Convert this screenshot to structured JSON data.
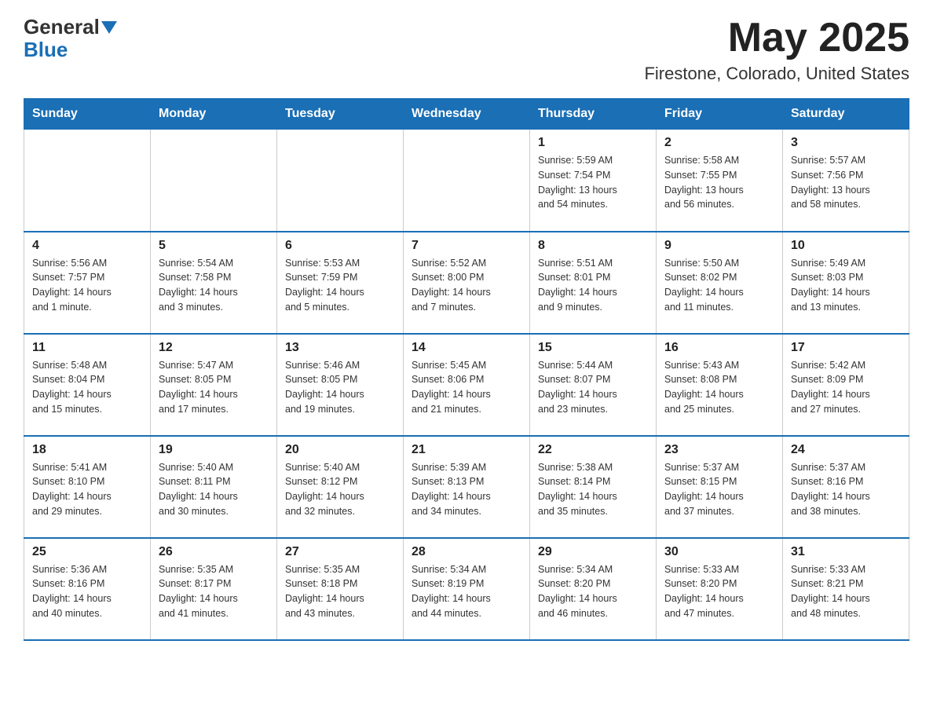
{
  "header": {
    "logo_text_black": "General",
    "logo_text_blue": "Blue",
    "title": "May 2025",
    "subtitle": "Firestone, Colorado, United States"
  },
  "days_of_week": [
    "Sunday",
    "Monday",
    "Tuesday",
    "Wednesday",
    "Thursday",
    "Friday",
    "Saturday"
  ],
  "weeks": [
    [
      {
        "day": "",
        "info": ""
      },
      {
        "day": "",
        "info": ""
      },
      {
        "day": "",
        "info": ""
      },
      {
        "day": "",
        "info": ""
      },
      {
        "day": "1",
        "info": "Sunrise: 5:59 AM\nSunset: 7:54 PM\nDaylight: 13 hours\nand 54 minutes."
      },
      {
        "day": "2",
        "info": "Sunrise: 5:58 AM\nSunset: 7:55 PM\nDaylight: 13 hours\nand 56 minutes."
      },
      {
        "day": "3",
        "info": "Sunrise: 5:57 AM\nSunset: 7:56 PM\nDaylight: 13 hours\nand 58 minutes."
      }
    ],
    [
      {
        "day": "4",
        "info": "Sunrise: 5:56 AM\nSunset: 7:57 PM\nDaylight: 14 hours\nand 1 minute."
      },
      {
        "day": "5",
        "info": "Sunrise: 5:54 AM\nSunset: 7:58 PM\nDaylight: 14 hours\nand 3 minutes."
      },
      {
        "day": "6",
        "info": "Sunrise: 5:53 AM\nSunset: 7:59 PM\nDaylight: 14 hours\nand 5 minutes."
      },
      {
        "day": "7",
        "info": "Sunrise: 5:52 AM\nSunset: 8:00 PM\nDaylight: 14 hours\nand 7 minutes."
      },
      {
        "day": "8",
        "info": "Sunrise: 5:51 AM\nSunset: 8:01 PM\nDaylight: 14 hours\nand 9 minutes."
      },
      {
        "day": "9",
        "info": "Sunrise: 5:50 AM\nSunset: 8:02 PM\nDaylight: 14 hours\nand 11 minutes."
      },
      {
        "day": "10",
        "info": "Sunrise: 5:49 AM\nSunset: 8:03 PM\nDaylight: 14 hours\nand 13 minutes."
      }
    ],
    [
      {
        "day": "11",
        "info": "Sunrise: 5:48 AM\nSunset: 8:04 PM\nDaylight: 14 hours\nand 15 minutes."
      },
      {
        "day": "12",
        "info": "Sunrise: 5:47 AM\nSunset: 8:05 PM\nDaylight: 14 hours\nand 17 minutes."
      },
      {
        "day": "13",
        "info": "Sunrise: 5:46 AM\nSunset: 8:05 PM\nDaylight: 14 hours\nand 19 minutes."
      },
      {
        "day": "14",
        "info": "Sunrise: 5:45 AM\nSunset: 8:06 PM\nDaylight: 14 hours\nand 21 minutes."
      },
      {
        "day": "15",
        "info": "Sunrise: 5:44 AM\nSunset: 8:07 PM\nDaylight: 14 hours\nand 23 minutes."
      },
      {
        "day": "16",
        "info": "Sunrise: 5:43 AM\nSunset: 8:08 PM\nDaylight: 14 hours\nand 25 minutes."
      },
      {
        "day": "17",
        "info": "Sunrise: 5:42 AM\nSunset: 8:09 PM\nDaylight: 14 hours\nand 27 minutes."
      }
    ],
    [
      {
        "day": "18",
        "info": "Sunrise: 5:41 AM\nSunset: 8:10 PM\nDaylight: 14 hours\nand 29 minutes."
      },
      {
        "day": "19",
        "info": "Sunrise: 5:40 AM\nSunset: 8:11 PM\nDaylight: 14 hours\nand 30 minutes."
      },
      {
        "day": "20",
        "info": "Sunrise: 5:40 AM\nSunset: 8:12 PM\nDaylight: 14 hours\nand 32 minutes."
      },
      {
        "day": "21",
        "info": "Sunrise: 5:39 AM\nSunset: 8:13 PM\nDaylight: 14 hours\nand 34 minutes."
      },
      {
        "day": "22",
        "info": "Sunrise: 5:38 AM\nSunset: 8:14 PM\nDaylight: 14 hours\nand 35 minutes."
      },
      {
        "day": "23",
        "info": "Sunrise: 5:37 AM\nSunset: 8:15 PM\nDaylight: 14 hours\nand 37 minutes."
      },
      {
        "day": "24",
        "info": "Sunrise: 5:37 AM\nSunset: 8:16 PM\nDaylight: 14 hours\nand 38 minutes."
      }
    ],
    [
      {
        "day": "25",
        "info": "Sunrise: 5:36 AM\nSunset: 8:16 PM\nDaylight: 14 hours\nand 40 minutes."
      },
      {
        "day": "26",
        "info": "Sunrise: 5:35 AM\nSunset: 8:17 PM\nDaylight: 14 hours\nand 41 minutes."
      },
      {
        "day": "27",
        "info": "Sunrise: 5:35 AM\nSunset: 8:18 PM\nDaylight: 14 hours\nand 43 minutes."
      },
      {
        "day": "28",
        "info": "Sunrise: 5:34 AM\nSunset: 8:19 PM\nDaylight: 14 hours\nand 44 minutes."
      },
      {
        "day": "29",
        "info": "Sunrise: 5:34 AM\nSunset: 8:20 PM\nDaylight: 14 hours\nand 46 minutes."
      },
      {
        "day": "30",
        "info": "Sunrise: 5:33 AM\nSunset: 8:20 PM\nDaylight: 14 hours\nand 47 minutes."
      },
      {
        "day": "31",
        "info": "Sunrise: 5:33 AM\nSunset: 8:21 PM\nDaylight: 14 hours\nand 48 minutes."
      }
    ]
  ]
}
